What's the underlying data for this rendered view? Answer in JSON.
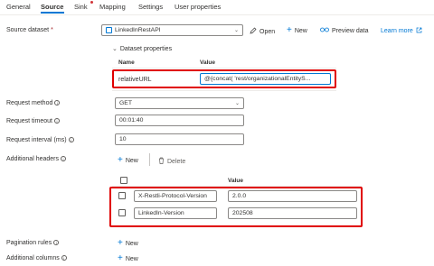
{
  "tabs": [
    {
      "label": "General"
    },
    {
      "label": "Source"
    },
    {
      "label": "Sink"
    },
    {
      "label": "Mapping"
    },
    {
      "label": "Settings"
    },
    {
      "label": "User properties"
    }
  ],
  "source_dataset": {
    "label": "Source dataset",
    "required_mark": "*",
    "value": "LinkedInRestAPI",
    "open_label": "Open",
    "new_label": "New",
    "preview_label": "Preview data",
    "learn_more_label": "Learn more"
  },
  "dataset_properties": {
    "title": "Dataset properties",
    "col_name": "Name",
    "col_value": "Value",
    "rows": [
      {
        "name": "relativeURL",
        "value": "@{concat( 'rest/organizationalEntityS..."
      }
    ]
  },
  "request_method": {
    "label": "Request method",
    "value": "GET"
  },
  "request_timeout": {
    "label": "Request timeout",
    "value": "00:01:40"
  },
  "request_interval": {
    "label": "Request interval (ms)",
    "value": "10"
  },
  "additional_headers": {
    "label": "Additional headers",
    "new_label": "New",
    "delete_label": "Delete",
    "col_value": "Value",
    "rows": [
      {
        "name": "X-Restli-Protocol-Version",
        "value": "2.0.0"
      },
      {
        "name": "LinkedIn-Version",
        "value": "202508"
      }
    ]
  },
  "pagination_rules": {
    "label": "Pagination rules",
    "new_label": "New"
  },
  "additional_columns": {
    "label": "Additional columns",
    "new_label": "New"
  },
  "icons": {
    "info": "i",
    "plus": "+",
    "chevron_down": "⌄",
    "chevron_expand": "⌄"
  },
  "colors": {
    "accent": "#0078d4",
    "highlight": "#e00000",
    "required": "#a4262c"
  }
}
